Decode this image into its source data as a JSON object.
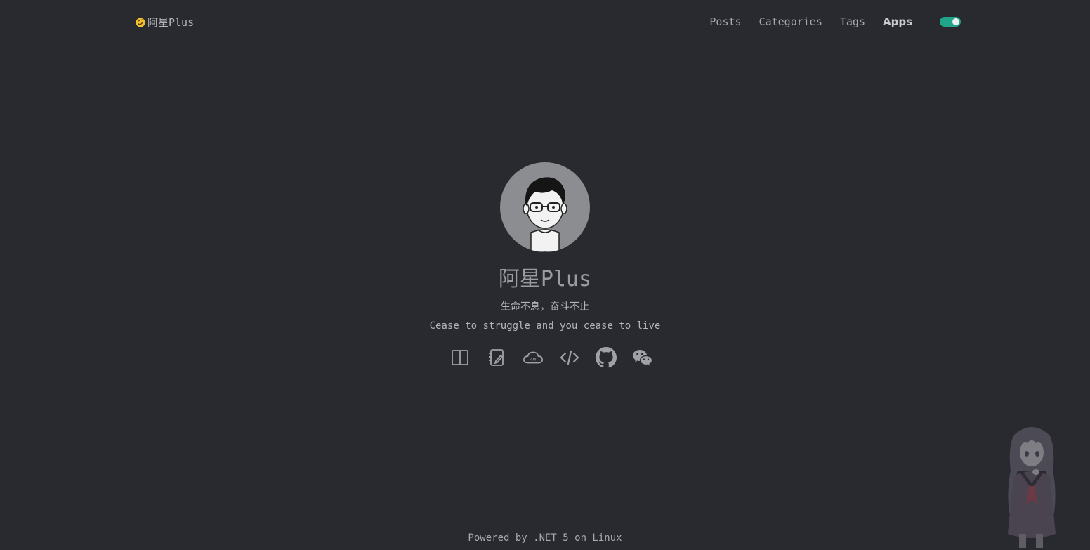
{
  "header": {
    "brand": "阿星Plus",
    "nav": [
      {
        "label": "Posts"
      },
      {
        "label": "Categories"
      },
      {
        "label": "Tags"
      },
      {
        "label": "Apps"
      }
    ],
    "theme_toggle_on": true
  },
  "profile": {
    "name": "阿星Plus",
    "motto_cn": "生命不息，奋斗不止",
    "motto_en": "Cease to struggle and you cease to live",
    "links": [
      "book-icon",
      "notebook-icon",
      "api-cloud-icon",
      "code-icon",
      "github-icon",
      "wechat-icon"
    ]
  },
  "footer": {
    "text": "Powered by .NET 5 on Linux"
  },
  "colors": {
    "background": "#292a2f",
    "toggle": "#20a58a",
    "avatar_bg": "#8c8d91"
  }
}
